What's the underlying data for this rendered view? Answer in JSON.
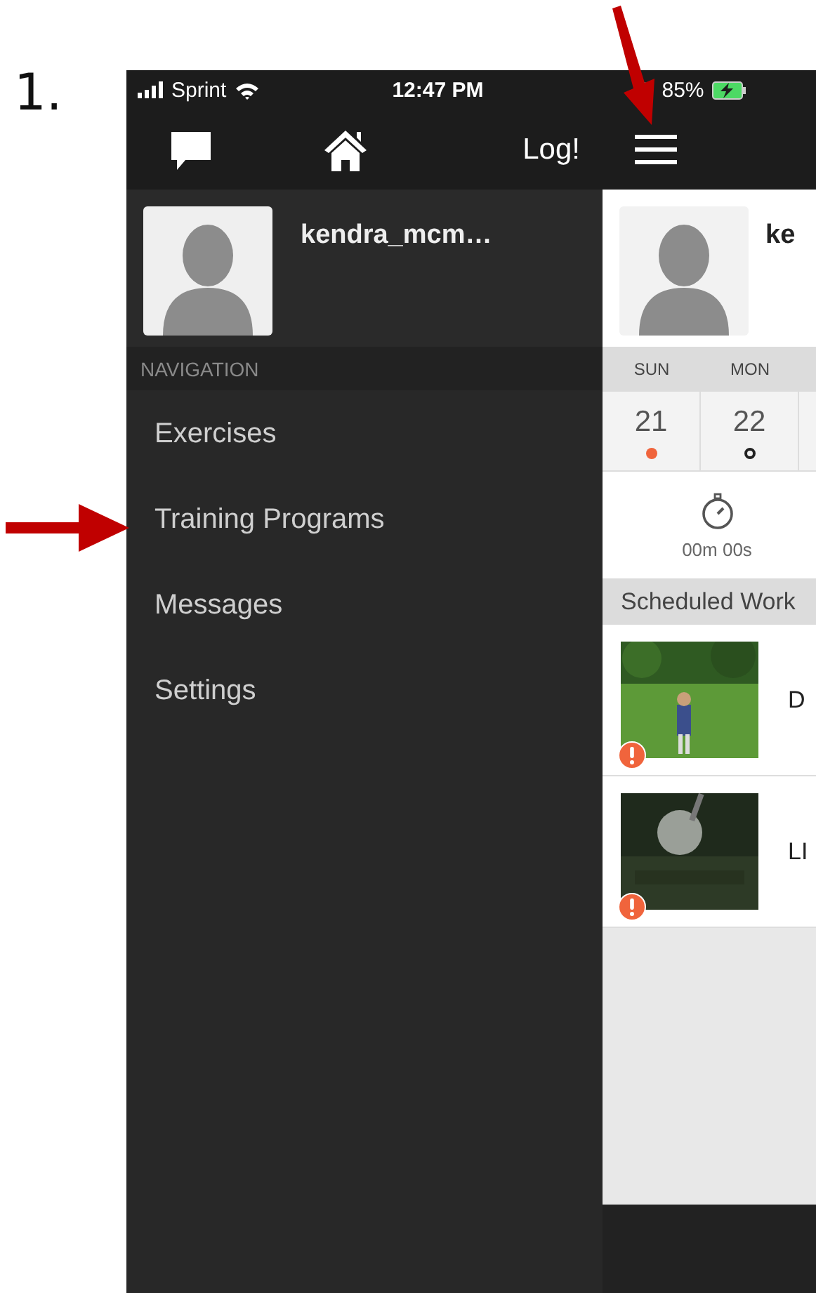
{
  "step": "1.",
  "status_bar": {
    "carrier": "Sprint",
    "time": "12:47 PM",
    "battery": "85%"
  },
  "sidebar": {
    "log_button": "Log!",
    "username": "kendra_mcm…",
    "section": "NAVIGATION",
    "items": [
      {
        "label": "Exercises"
      },
      {
        "label": "Training Programs"
      },
      {
        "label": "Messages"
      },
      {
        "label": "Settings"
      }
    ]
  },
  "main": {
    "username": "ke",
    "days": [
      {
        "weekday": "SUN",
        "date": "21",
        "kind": "dot",
        "color": "#f0643c"
      },
      {
        "weekday": "MON",
        "date": "22",
        "kind": "ring",
        "color": "#222222"
      }
    ],
    "timer": "00m 00s",
    "section": "Scheduled Work",
    "workouts": [
      {
        "title": "D",
        "alert": true
      },
      {
        "title": "LI",
        "alert": true
      }
    ]
  }
}
